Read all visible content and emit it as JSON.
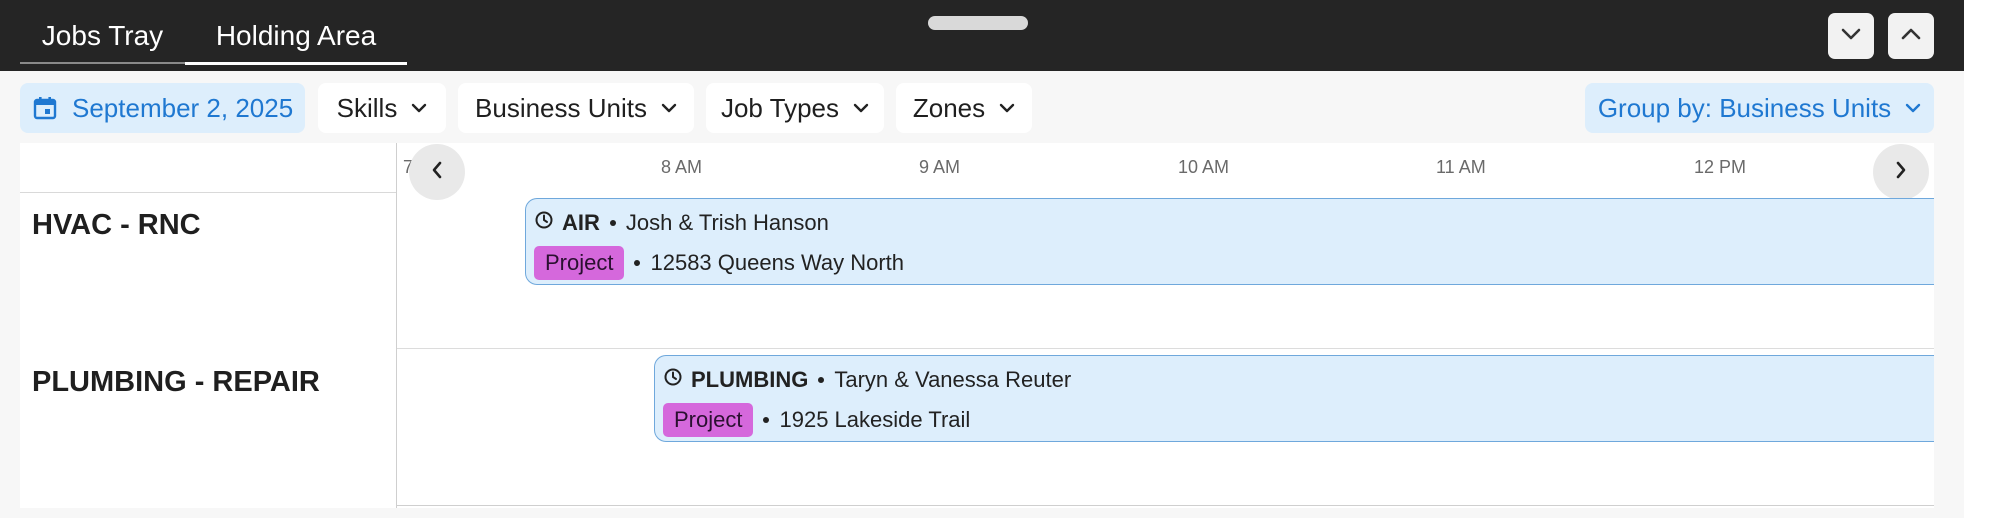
{
  "header": {
    "tabs": [
      {
        "label": "Jobs Tray",
        "active": false
      },
      {
        "label": "Holding Area",
        "active": true
      }
    ]
  },
  "toolbar": {
    "date": "September 2, 2025",
    "filters": {
      "skills": "Skills",
      "business_units": "Business Units",
      "job_types": "Job Types",
      "zones": "Zones"
    },
    "group_by": "Group by: Business Units"
  },
  "timeline": {
    "hours": [
      "7 AM",
      "8 AM",
      "9 AM",
      "10 AM",
      "11 AM",
      "12 PM"
    ]
  },
  "groups": [
    {
      "label": "HVAC - RNC",
      "job": {
        "type": "AIR",
        "customer": "Josh & Trish Hanson",
        "tag": "Project",
        "address": "12583 Queens Way North"
      }
    },
    {
      "label": "PLUMBING - REPAIR",
      "job": {
        "type": "PLUMBING",
        "customer": "Taryn & Vanessa Reuter",
        "tag": "Project",
        "address": "1925 Lakeside Trail"
      }
    }
  ],
  "colors": {
    "header_bg": "#252525",
    "accent_blue": "#1f78d1",
    "chip_blue_bg": "#ddeefc",
    "job_card_bg": "#ddeefc",
    "project_tag": "#d568dc"
  },
  "icons": {
    "date": "calendar-icon",
    "dropdown": "chevron-down-icon",
    "collapse": "chevron-down-icon",
    "expand": "chevron-up-icon",
    "prev": "chevron-left-icon",
    "next": "chevron-right-icon",
    "job": "clock-icon"
  }
}
